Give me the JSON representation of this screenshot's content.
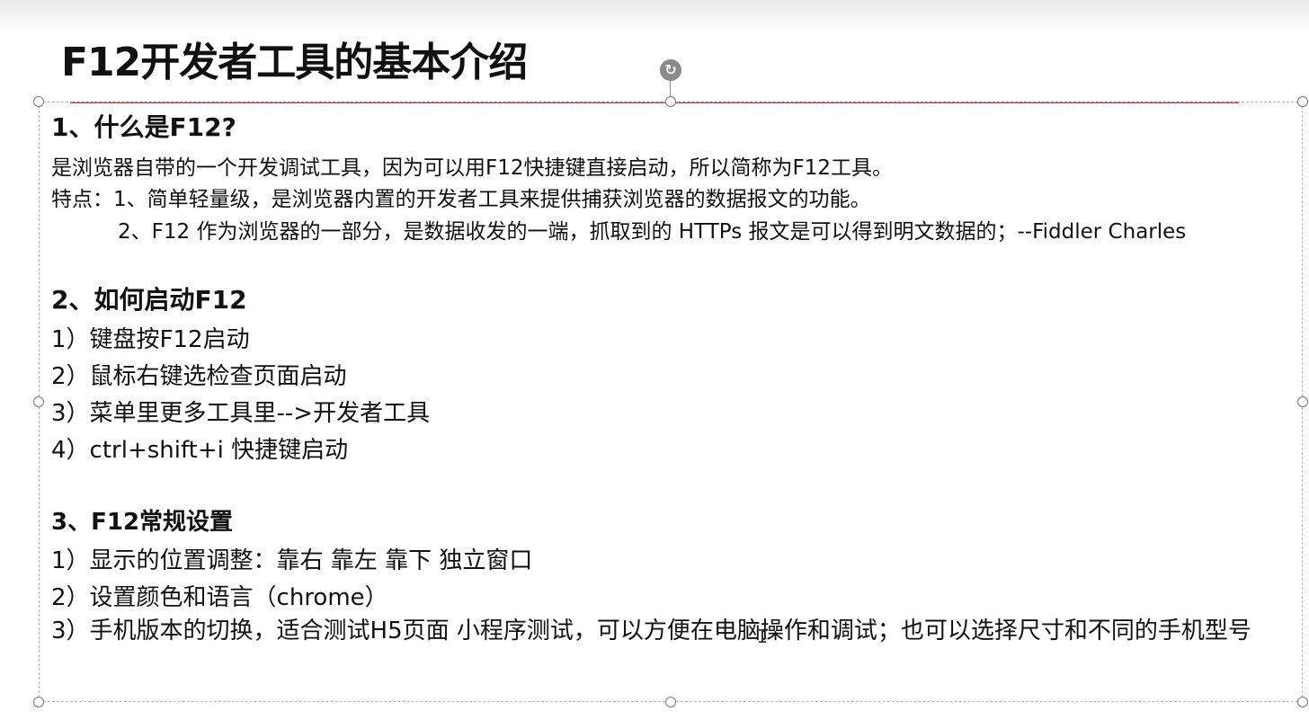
{
  "slide": {
    "title": "F12开发者工具的基本介绍"
  },
  "section1": {
    "heading": "1、什么是F12?",
    "desc": "是浏览器自带的一个开发调试工具，因为可以用F12快捷键直接启动，所以简称为F12工具。",
    "feature1": "特点：1、简单轻量级，是浏览器内置的开发者工具来提供捕获浏览器的数据报文的功能。",
    "feature2": "2、F12 作为浏览器的一部分，是数据收发的一端，抓取到的 HTTPs 报文是可以得到明文数据的；--Fiddler Charles"
  },
  "section2": {
    "heading": "2、如何启动F12",
    "items": [
      "1）键盘按F12启动",
      "2）鼠标右键选检查页面启动",
      "3）菜单里更多工具里-->开发者工具",
      "4）ctrl+shift+i 快捷键启动"
    ]
  },
  "section3": {
    "heading": "3、F12常规设置",
    "items": [
      "1）显示的位置调整：靠右 靠左  靠下  独立窗口",
      "2）设置颜色和语言（chrome）",
      "3）手机版本的切换，适合测试H5页面 小程序测试，可以方便在电脑操作和调试；也可以选择尺寸和不同的手机型号"
    ]
  },
  "colors": {
    "title_rule": "#c0504d",
    "text": "#111111",
    "handle_border": "#777777"
  },
  "icons": {
    "rotate_handle": "rotate-icon",
    "cursor": "text-cursor-icon"
  }
}
